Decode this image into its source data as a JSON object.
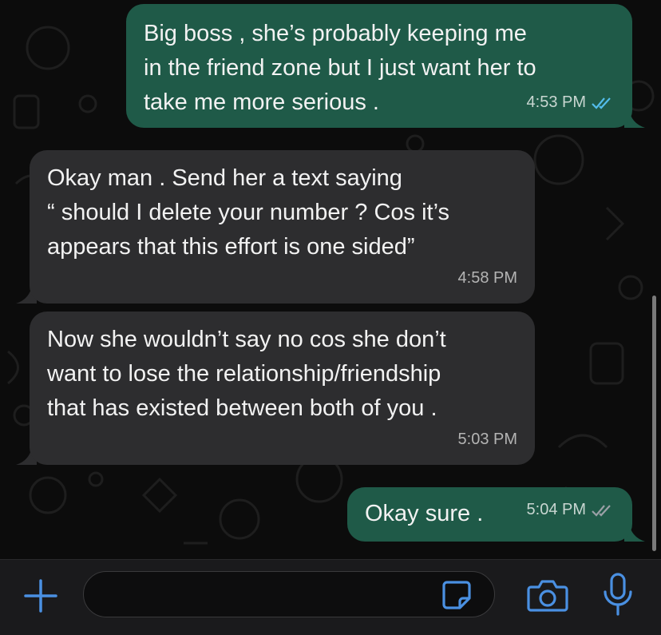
{
  "messages": [
    {
      "direction": "outgoing",
      "text": "Big boss , she’s probably keeping me\nin the friend zone but I just want her to\ntake me more serious .",
      "time": "4:53 PM",
      "status": "read"
    },
    {
      "direction": "incoming",
      "text": "Okay man . Send her a text saying\n“ should I delete your number ? Cos it’s\nappears that this effort is one sided”",
      "time": "4:58 PM"
    },
    {
      "direction": "incoming",
      "text": "Now she wouldn’t say no cos she don’t\nwant to lose the relationship/friendship\nthat has existed between both of you .",
      "time": "5:03 PM"
    },
    {
      "direction": "outgoing",
      "text": "Okay sure .",
      "time": "5:04 PM",
      "status": "delivered"
    }
  ],
  "input_bar": {
    "message_value": "",
    "icons": [
      "plus-icon",
      "sticker-icon",
      "camera-icon",
      "microphone-icon"
    ]
  },
  "colors": {
    "outgoing_bubble": "#1f5a48",
    "incoming_bubble": "#2d2d2f",
    "accent": "#4a90e2",
    "read_ticks": "#53bdeb",
    "delivered_ticks": "#9aa0a6"
  }
}
